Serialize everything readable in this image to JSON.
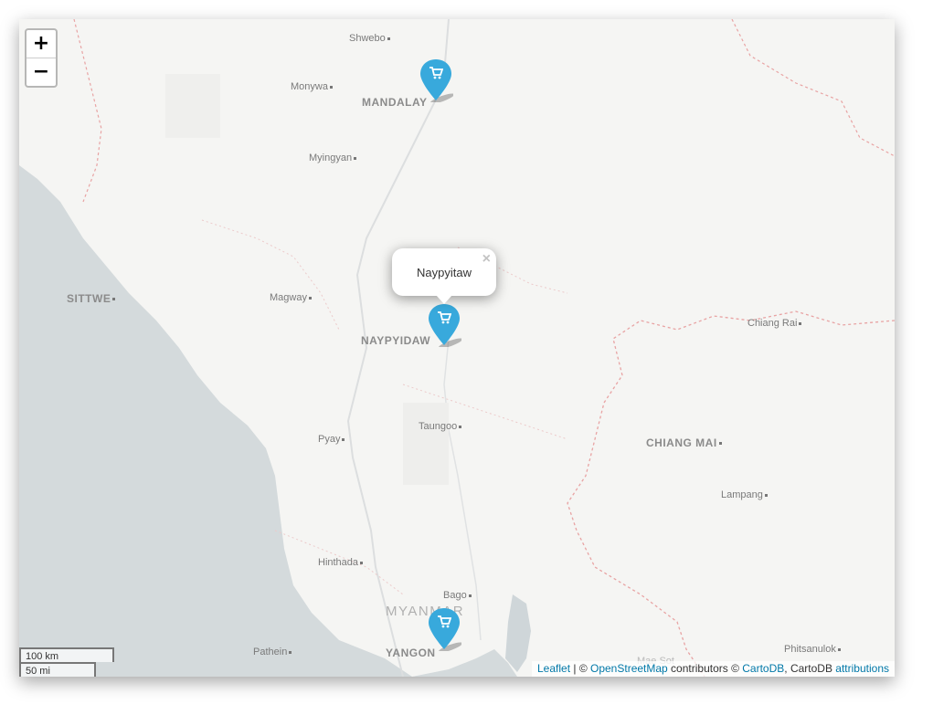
{
  "zoom_control": {
    "zoom_in_label": "+",
    "zoom_out_label": "−"
  },
  "popup": {
    "text": "Naypyitaw",
    "close_label": "×"
  },
  "cities": {
    "shwebo": "Shwebo",
    "monywa": "Monywa",
    "mandalay": "MANDALAY",
    "myingyan": "Myingyan",
    "sittwe": "SITTWE",
    "magway": "Magway",
    "naypyidaw": "NAYPYIDAW",
    "taungoo": "Taungoo",
    "pyay": "Pyay",
    "chiang_rai": "Chiang Rai",
    "chiang_mai": "CHIANG MAI",
    "lampang": "Lampang",
    "hinthada": "Hinthada",
    "bago": "Bago",
    "myanmar": "MYANMAR",
    "pathein": "Pathein",
    "yangon": "YANGON",
    "phitsanulok": "Phitsanulok",
    "mae_sot": "Mae Sot"
  },
  "markers": [
    {
      "name": "Mandalay",
      "icon": "shopping-cart-icon"
    },
    {
      "name": "Naypyitaw",
      "icon": "shopping-cart-icon"
    },
    {
      "name": "Yangon",
      "icon": "shopping-cart-icon"
    }
  ],
  "scale": {
    "metric": "100 km",
    "imperial": "50 mi"
  },
  "attribution": {
    "leaflet": "Leaflet",
    "sep1": " | © ",
    "osm": "OpenStreetMap",
    "contrib": " contributors © ",
    "cartodb": "CartoDB",
    "mid": ", CartoDB ",
    "attributions": "attributions"
  },
  "colors": {
    "marker": "#38a9dc",
    "link": "#0078a8",
    "water": "#d4dadc",
    "land": "#f5f5f3",
    "border": "#e8a3a3"
  }
}
